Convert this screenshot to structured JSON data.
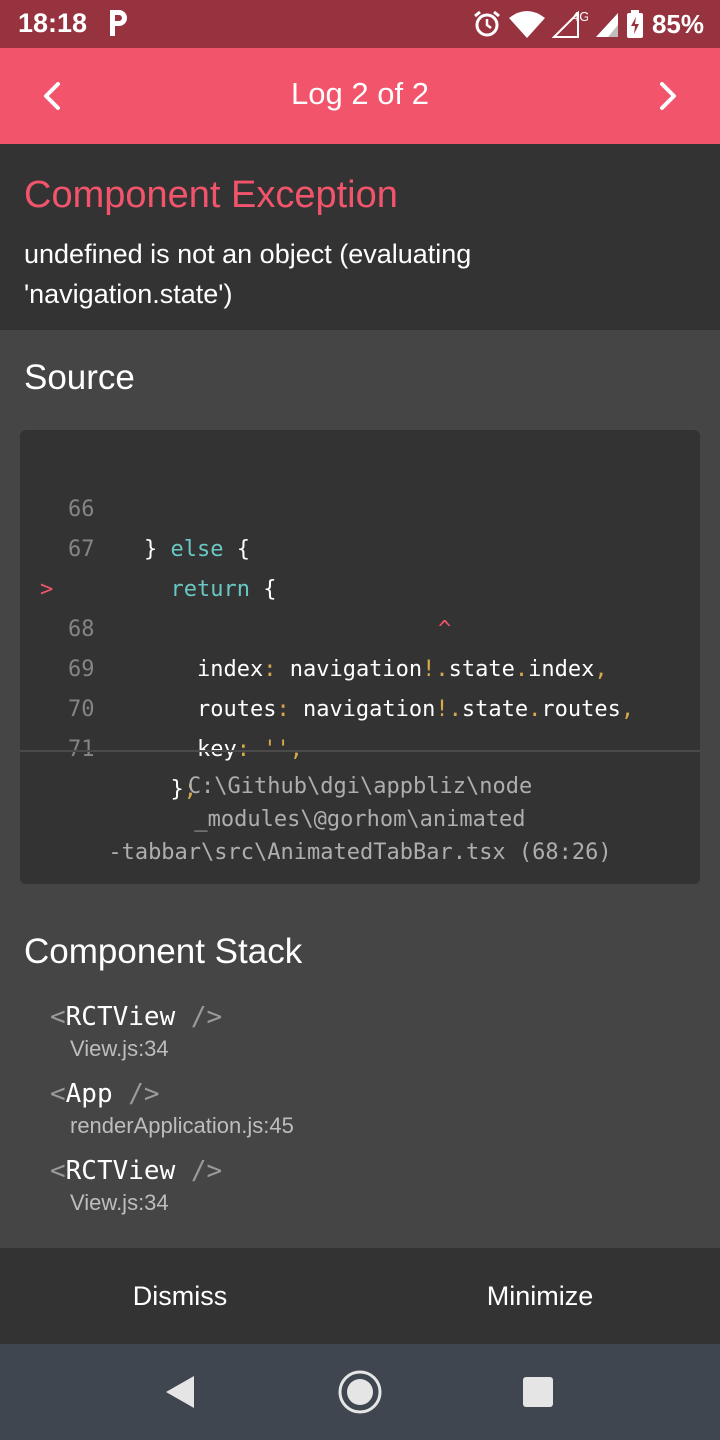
{
  "status_bar": {
    "time": "18:18",
    "network": "4G",
    "battery": "85%"
  },
  "app_bar": {
    "title": "Log 2 of 2"
  },
  "error": {
    "title": "Component Exception",
    "message": "undefined is not an object (evaluating 'navigation.state')"
  },
  "source": {
    "heading": "Source",
    "lines": [
      {
        "num": "66",
        "text": "} else {"
      },
      {
        "num": "67",
        "text": "  return {"
      },
      {
        "num": "68",
        "text": "    index: navigation!.state.index,",
        "highlighted": true
      },
      {
        "num": "",
        "text": "^"
      },
      {
        "num": "69",
        "text": "    routes: navigation!.state.routes,"
      },
      {
        "num": "70",
        "text": "    key: '',"
      },
      {
        "num": "71",
        "text": "  };"
      }
    ],
    "file_path": "C:\\Github\\dgi\\appbliz\\node\n_modules\\@gorhom\\animated\n-tabbar\\src\\AnimatedTabBar.tsx (68:26)"
  },
  "component_stack": {
    "heading": "Component Stack",
    "frames": [
      {
        "name": "RCTView",
        "location": "View.js:34"
      },
      {
        "name": "App",
        "location": "renderApplication.js:45"
      },
      {
        "name": "RCTView",
        "location": "View.js:34"
      }
    ]
  },
  "actions": {
    "dismiss": "Dismiss",
    "minimize": "Minimize"
  },
  "colors": {
    "accent": "#f2546b",
    "status_bar": "#97323f",
    "header_bg": "#333333",
    "body_bg": "#454545",
    "keyword": "#69c7c4",
    "punctuation": "#d8a94c"
  },
  "icons": {
    "prev": "chevron-left-icon",
    "next": "chevron-right-icon",
    "back": "triangle-back-icon",
    "home": "circle-home-icon",
    "recent": "square-recent-icon"
  }
}
